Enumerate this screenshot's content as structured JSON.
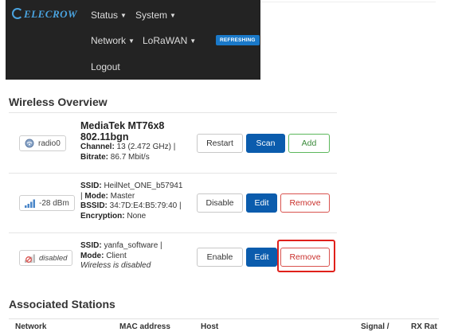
{
  "header": {
    "brand": "ELECROW",
    "menu": {
      "status": "Status",
      "system": "System",
      "network": "Network",
      "lorawan": "LoRaWAN",
      "logout": "Logout"
    },
    "refresh_badge": "REFRESHING"
  },
  "wireless": {
    "title": "Wireless Overview",
    "radio": {
      "badge": "radio0",
      "name_line1": "MediaTek MT76x8",
      "name_line2": "802.11bgn",
      "channel_label": "Channel:",
      "channel_value": " 13 (2.472 GHz) |",
      "bitrate_label": "Bitrate:",
      "bitrate_value": " 86.7 Mbit/s",
      "buttons": {
        "restart": "Restart",
        "scan": "Scan",
        "add": "Add"
      }
    },
    "networks": [
      {
        "badge": "-28 dBm",
        "ssid_label": "SSID:",
        "ssid_value": " HeilNet_ONE_b57941",
        "mode_prefix": "| ",
        "mode_label": "Mode:",
        "mode_value": " Master",
        "bssid_label": "BSSID:",
        "bssid_value": " 34:7D:E4:B5:79:40 |",
        "enc_label": "Encryption:",
        "enc_value": " None",
        "buttons": {
          "toggle": "Disable",
          "edit": "Edit",
          "remove": "Remove"
        }
      },
      {
        "badge": "disabled",
        "ssid_label": "SSID:",
        "ssid_value": " yanfa_software |",
        "mode_label": "Mode:",
        "mode_value": " Client",
        "status_text": "Wireless is disabled",
        "buttons": {
          "toggle": "Enable",
          "edit": "Edit",
          "remove": "Remove"
        }
      }
    ]
  },
  "stations": {
    "title": "Associated Stations",
    "columns": [
      "Network",
      "MAC address",
      "Host",
      "Signal /",
      "RX Rat"
    ]
  },
  "colors": {
    "primary": "#0b5cad",
    "header_bg": "#232323",
    "highlight": "#e0201b",
    "brand": "#4aa3df"
  }
}
